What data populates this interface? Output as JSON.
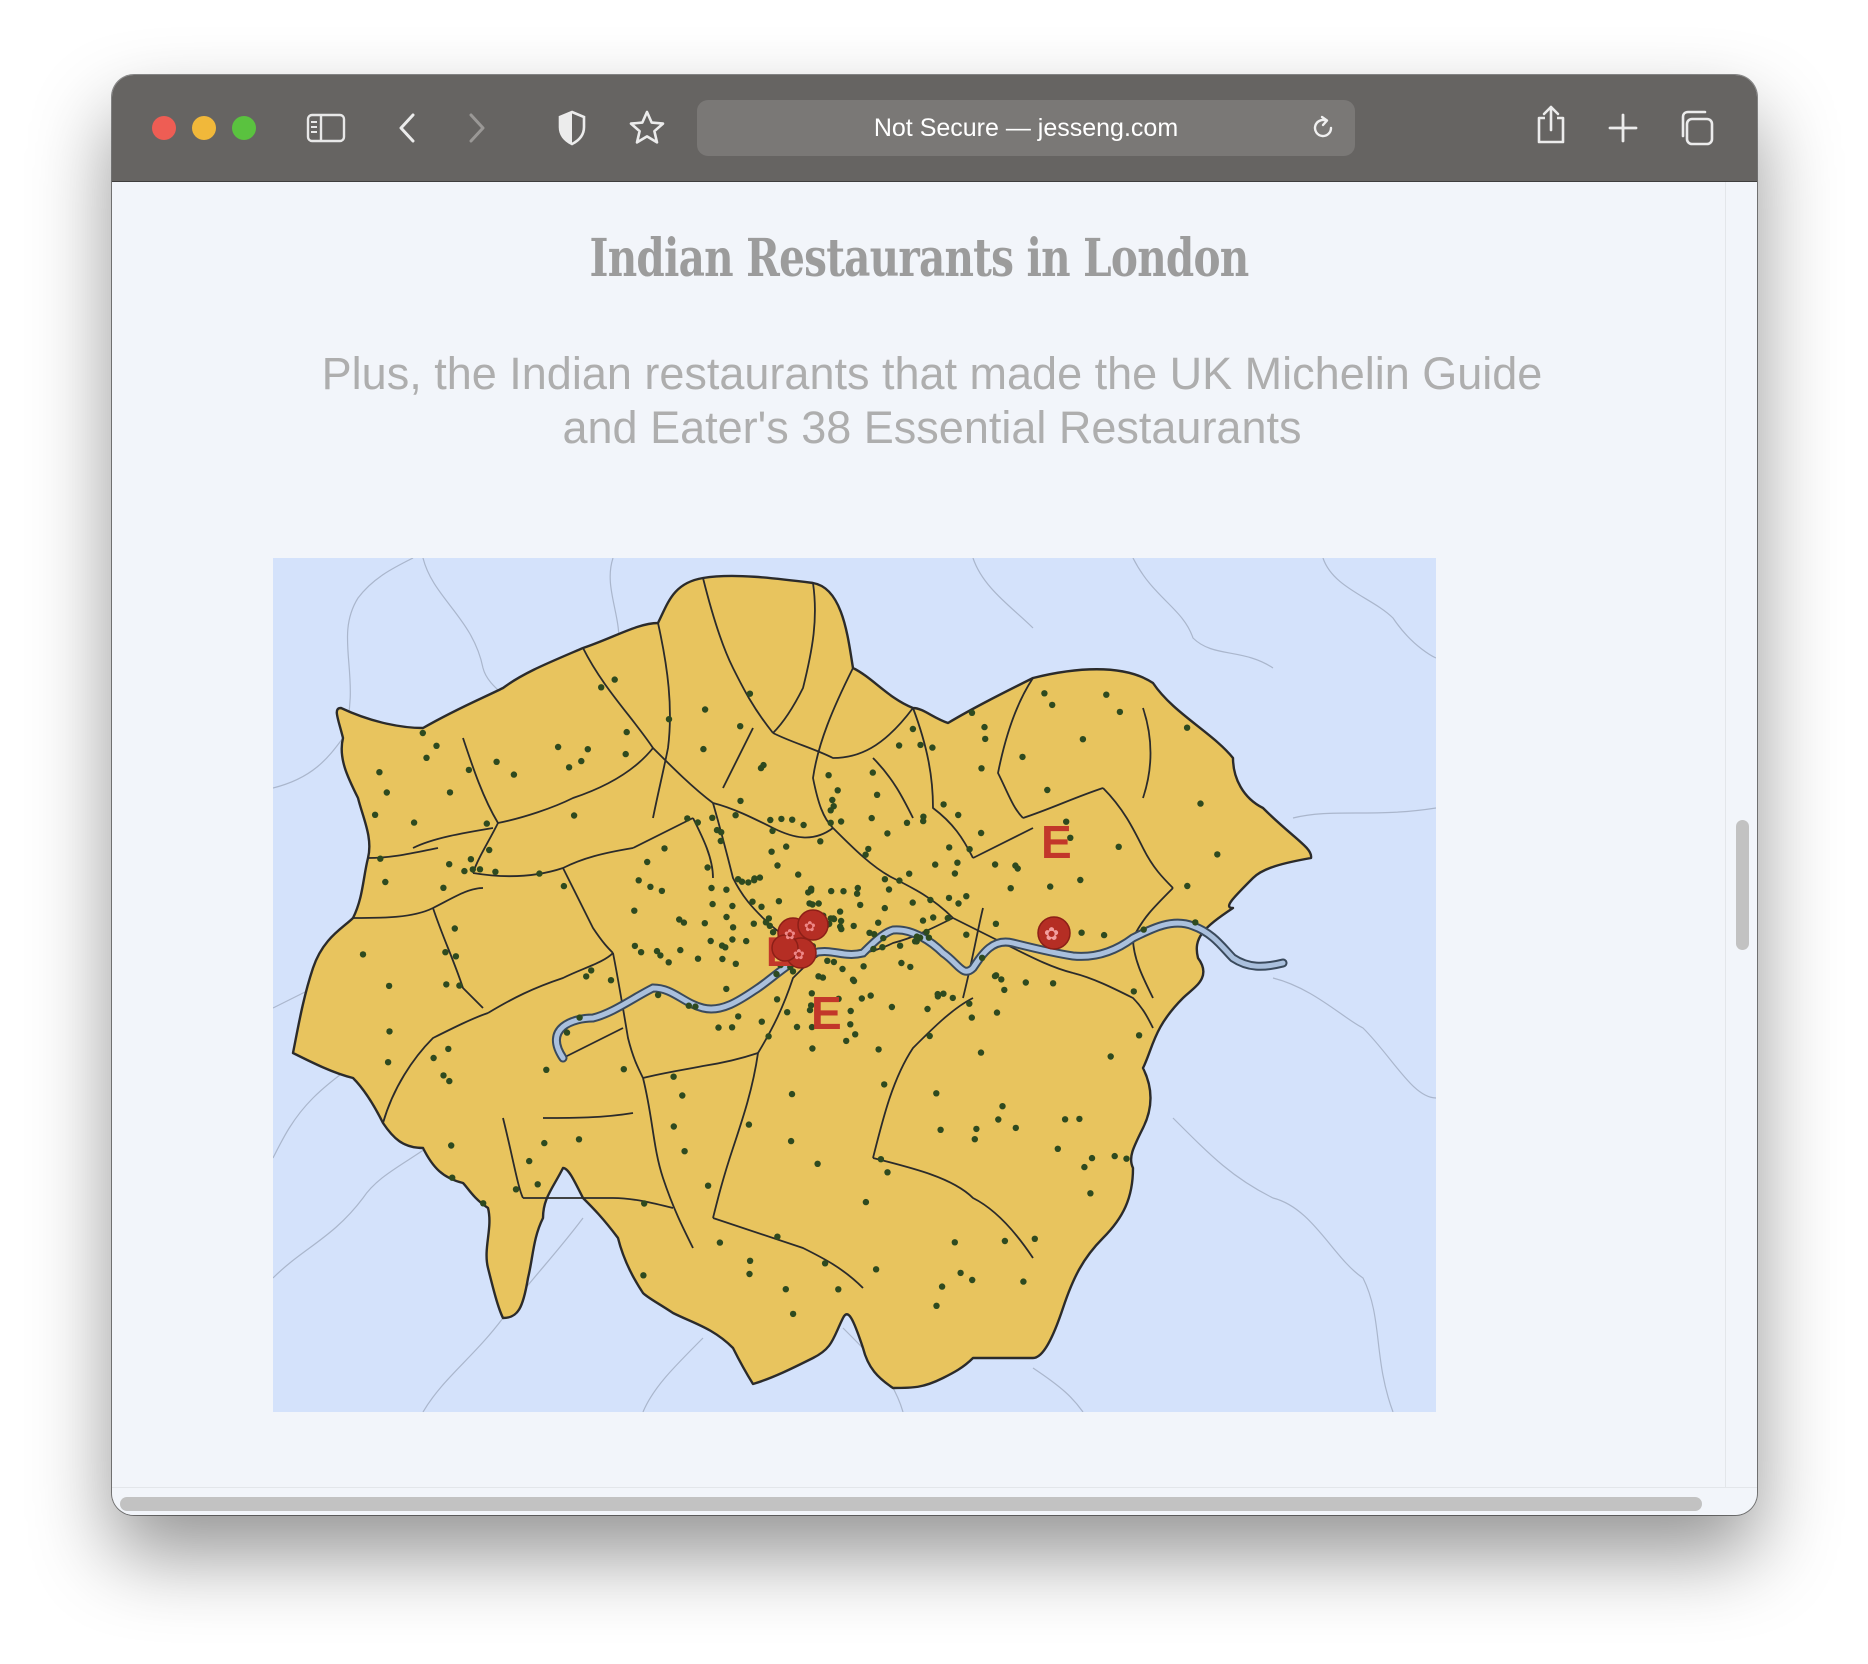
{
  "browser": {
    "address": "Not Secure — jesseng.com",
    "icons": [
      "sidebar-icon",
      "back-icon",
      "forward-icon",
      "privacy-shield-icon",
      "bookmark-star-icon",
      "reload-icon",
      "share-icon",
      "new-tab-icon",
      "tab-overview-icon"
    ]
  },
  "page": {
    "title": "Indian Restaurants in London",
    "subtitle": "Plus, the Indian restaurants that made the UK Michelin Guide and Eater's 38 Essential Restaurants"
  },
  "map": {
    "colors": {
      "water": "#d4e2fb",
      "borough": "#e8c45e",
      "border": "#2b2b2b",
      "river": "#7f96b0",
      "restaurant_dot": "#2e4a1f",
      "marker": "#c2372a"
    },
    "legend_marks": [
      "E",
      "michelin-rosette"
    ]
  }
}
